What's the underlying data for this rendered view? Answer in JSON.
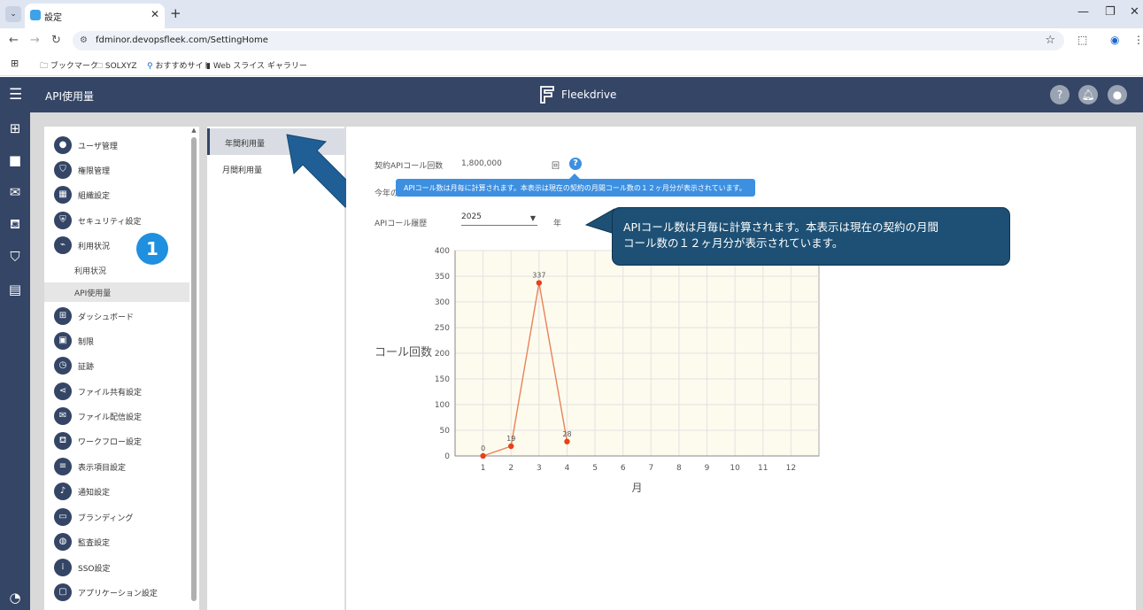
{
  "browser": {
    "tab_title": "設定",
    "tab_close": "✕",
    "new_tab": "+",
    "url": "fdminor.devopsfleek.com/SettingHome",
    "bookmarks": [
      "ブックマーク",
      "SOLXYZ",
      "おすすめサイト",
      "Web スライス ギャラリー"
    ]
  },
  "header": {
    "title": "API使用量",
    "brand": "Fleekdrive",
    "help": "?"
  },
  "settings_nav": {
    "items": [
      {
        "label": "ユーザ管理",
        "icon": "user-icon"
      },
      {
        "label": "権限管理",
        "icon": "shield-icon"
      },
      {
        "label": "組織設定",
        "icon": "organization-icon"
      },
      {
        "label": "セキュリティ設定",
        "icon": "security-icon"
      },
      {
        "label": "利用状況",
        "icon": "chart-icon"
      },
      {
        "label": "ダッシュボード",
        "icon": "dashboard-icon"
      },
      {
        "label": "制限",
        "icon": "limit-icon"
      },
      {
        "label": "証跡",
        "icon": "clock-icon"
      },
      {
        "label": "ファイル共有設定",
        "icon": "share-icon"
      },
      {
        "label": "ファイル配信設定",
        "icon": "mail-icon"
      },
      {
        "label": "ワークフロー設定",
        "icon": "workflow-icon"
      },
      {
        "label": "表示項目設定",
        "icon": "list-icon"
      },
      {
        "label": "通知設定",
        "icon": "bell-icon"
      },
      {
        "label": "ブランディング",
        "icon": "branding-icon"
      },
      {
        "label": "監査設定",
        "icon": "audit-icon"
      },
      {
        "label": "SSO設定",
        "icon": "sso-icon"
      },
      {
        "label": "アプリケーション設定",
        "icon": "app-icon"
      }
    ],
    "sub_items": [
      "利用状況",
      "API使用量"
    ],
    "badge": "1"
  },
  "tabs": [
    "年間利用量",
    "月間利用量"
  ],
  "main": {
    "contract_label": "契約APIコール回数",
    "contract_value": "1,800,000",
    "contract_unit": "回",
    "year_label_partial": "今年の",
    "tooltip": "APIコール数は月毎に計算されます。本表示は現在の契約の月間コール数の１２ヶ月分が表示されています。",
    "history_label": "APIコール履歴",
    "year_value": "2025",
    "year_unit": "年"
  },
  "callout": {
    "line1": "APIコール数は月毎に計算されます。本表示は現在の契約の月間",
    "line2": "コール数の１２ヶ月分が表示されています。"
  },
  "chart_data": {
    "type": "line",
    "x": [
      1,
      2,
      3,
      4
    ],
    "values": [
      0,
      19,
      337,
      28
    ],
    "categories": [
      "1",
      "2",
      "3",
      "4",
      "5",
      "6",
      "7",
      "8",
      "9",
      "10",
      "11",
      "12"
    ],
    "xlabel": "月",
    "ylabel": "コール回数",
    "ylim": [
      0,
      400
    ],
    "yticks": [
      0,
      50,
      100,
      150,
      200,
      250,
      300,
      350,
      400
    ],
    "grid": true,
    "line_color": "#e8825a",
    "point_color": "#e8401c",
    "background": "#fdfbee"
  }
}
